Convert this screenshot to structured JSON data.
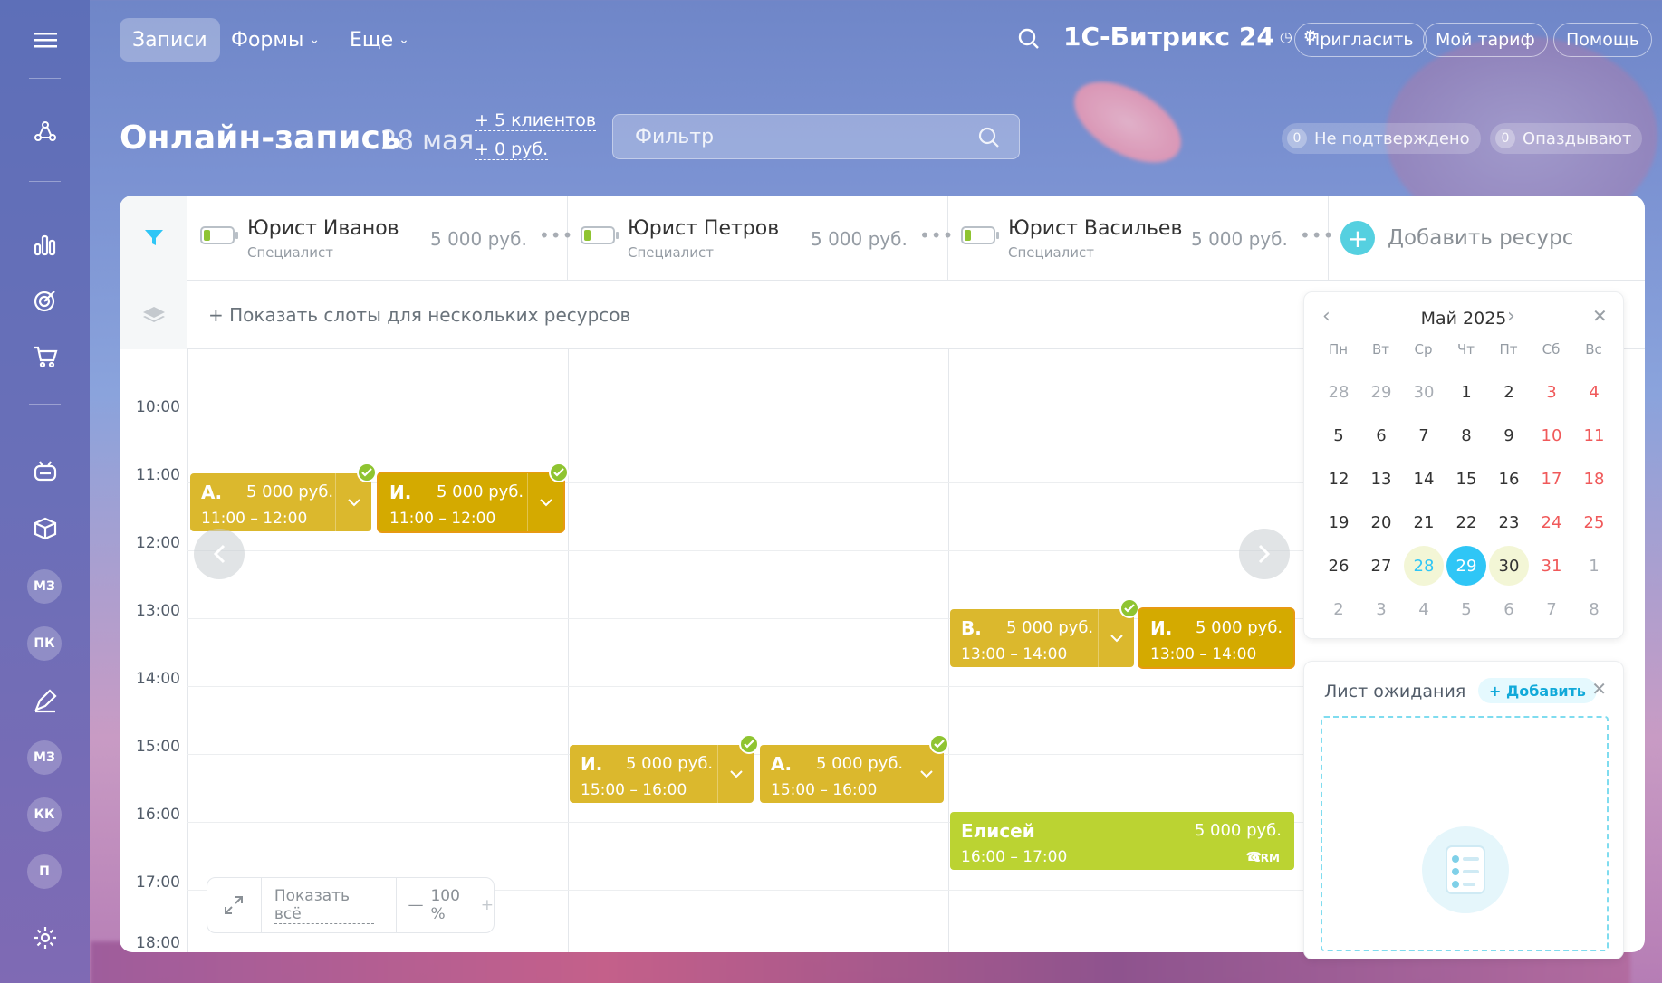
{
  "topbar": {
    "tabs": [
      {
        "label": "Записи",
        "active": true
      },
      {
        "label": "Формы",
        "caret": true
      },
      {
        "label": "Еще",
        "caret": true
      }
    ],
    "brand": "1С-Битрикс 24",
    "buttons": {
      "invite": "Пригласить",
      "tariff": "Мой тариф",
      "help": "Помощь"
    }
  },
  "rail": {
    "avatars": [
      "МЗ",
      "ПК",
      "МЗ",
      "КК",
      "П"
    ]
  },
  "header": {
    "title": "Онлайн-запись",
    "date": "28 мая",
    "clients": "+ 5 клиентов",
    "money": "+ 0 руб.",
    "filter_placeholder": "Фильтр",
    "unconfirmed": {
      "count": "0",
      "label": "Не подтверждено"
    },
    "late": {
      "count": "0",
      "label": "Опаздывают"
    }
  },
  "resources": [
    {
      "name": "Юрист Иванов",
      "role": "Специалист",
      "price": "5 000 руб."
    },
    {
      "name": "Юрист Петров",
      "role": "Специалист",
      "price": "5 000 руб."
    },
    {
      "name": "Юрист Васильев",
      "role": "Специалист",
      "price": "5 000 руб."
    }
  ],
  "add_resource": "Добавить ресурс",
  "show_slots": "+ Показать слоты для нескольких ресурсов",
  "hours": [
    "10:00",
    "11:00",
    "12:00",
    "13:00",
    "14:00",
    "15:00",
    "16:00",
    "17:00",
    "18:00"
  ],
  "events": [
    {
      "initial": "А.",
      "price": "5 000 руб.",
      "time": "11:00 – 12:00"
    },
    {
      "initial": "И.",
      "price": "5 000 руб.",
      "time": "11:00 – 12:00"
    },
    {
      "initial": "В.",
      "price": "5 000 руб.",
      "time": "13:00 – 14:00"
    },
    {
      "initial": "И.",
      "price": "5 000 руб.",
      "time": "13:00 – 14:00"
    },
    {
      "initial": "И.",
      "price": "5 000 руб.",
      "time": "15:00 – 16:00"
    },
    {
      "initial": "А.",
      "price": "5 000 руб.",
      "time": "15:00 – 16:00"
    },
    {
      "initial": "Елисей",
      "price": "5 000 руб.",
      "time": "16:00 – 17:00",
      "crm": "CRM"
    }
  ],
  "zoom": {
    "show_all": "Показать всё",
    "value": "100 %"
  },
  "calendar": {
    "month": "Май 2025",
    "weekdays": [
      "Пн",
      "Вт",
      "Ср",
      "Чт",
      "Пт",
      "Сб",
      "Вс"
    ],
    "weeks": [
      [
        "28",
        "29",
        "30",
        "1",
        "2",
        "3",
        "4"
      ],
      [
        "5",
        "6",
        "7",
        "8",
        "9",
        "10",
        "11"
      ],
      [
        "12",
        "13",
        "14",
        "15",
        "16",
        "17",
        "18"
      ],
      [
        "19",
        "20",
        "21",
        "22",
        "23",
        "24",
        "25"
      ],
      [
        "26",
        "27",
        "28",
        "29",
        "30",
        "31",
        "1"
      ],
      [
        "2",
        "3",
        "4",
        "5",
        "6",
        "7",
        "8"
      ]
    ]
  },
  "waitlist": {
    "title": "Лист ожидания",
    "add": "+ Добавить"
  },
  "colors": {
    "event_yellow": "#dbb82d",
    "event_dark_yellow": "#d4aa00",
    "event_green": "#bbd332",
    "accent": "#2fc6f6"
  }
}
